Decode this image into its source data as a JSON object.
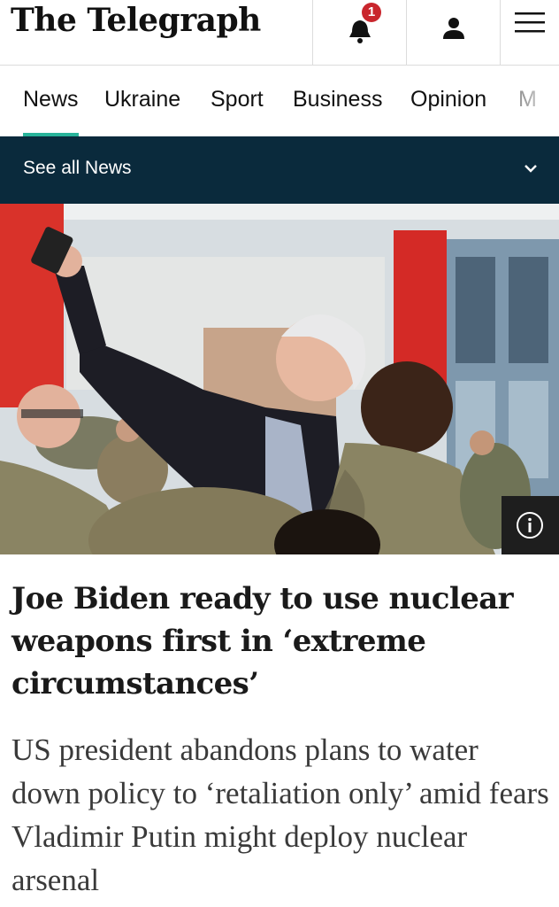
{
  "header": {
    "logo_text": "The Telegraph",
    "notification_count": "1",
    "notification_icon": "bell-icon",
    "account_icon": "person-icon",
    "menu_icon": "hamburger-menu-icon"
  },
  "tabs": [
    {
      "label": "News",
      "active": true
    },
    {
      "label": "Ukraine"
    },
    {
      "label": "Sport"
    },
    {
      "label": "Business"
    },
    {
      "label": "Opinion"
    },
    {
      "label": "M"
    }
  ],
  "section_bar": {
    "label": "See all News",
    "icon": "chevron-down-icon"
  },
  "article": {
    "headline": "Joe Biden ready to use nuclear weapons first in ‘extreme circumstances’",
    "standfirst": "US president abandons plans to water down policy to ‘retaliation only’ amid fears Vladimir Putin might deploy nuclear arsenal",
    "image_info_icon": "info-icon"
  },
  "colors": {
    "accent": "#28b39a",
    "section_bar": "#0a2a3c",
    "badge": "#c9262d"
  }
}
